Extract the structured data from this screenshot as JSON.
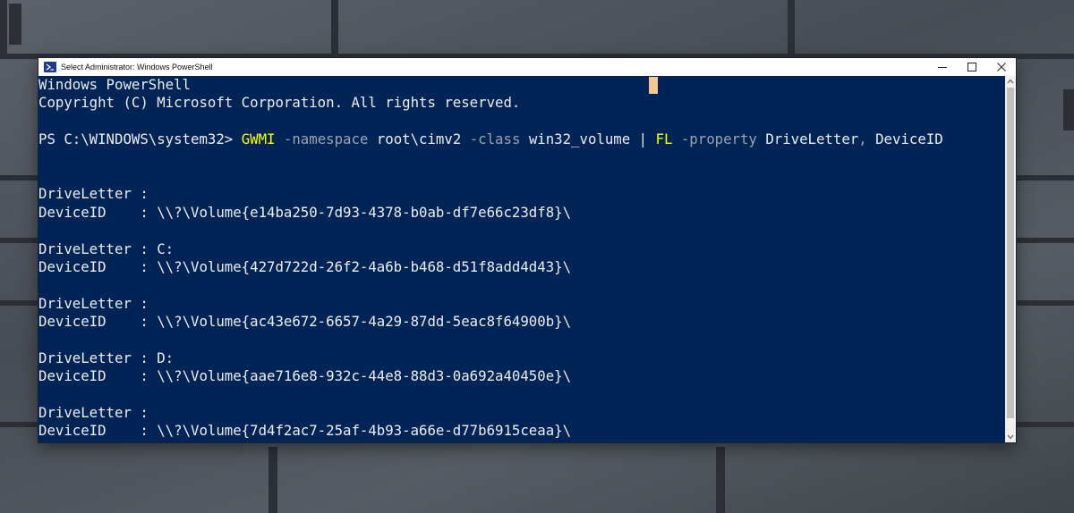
{
  "window": {
    "title": "Select Administrator: Windows PowerShell",
    "icon": "powershell-icon",
    "controls": [
      "minimize-icon",
      "maximize-icon",
      "close-icon"
    ]
  },
  "colors": {
    "console_bg": "#012456",
    "console_text": "#eeedf0",
    "command": "#ffff00",
    "parameter": "#9ca3af",
    "cursor": "#f5c891"
  },
  "console": {
    "header1": "Windows PowerShell",
    "header2": "Copyright (C) Microsoft Corporation. All rights reserved.",
    "prompt": "PS C:\\WINDOWS\\system32> ",
    "command": {
      "cmdlet": "GWMI",
      "sp1": " ",
      "param1": "-namespace",
      "arg1": " root\\cimv2 ",
      "param2": "-class",
      "arg2": " win32_volume ",
      "pipe": "| ",
      "cmdlet2": "FL",
      "sp2": " ",
      "param3": "-property",
      "arg3": " DriveLetter",
      "comma": ",",
      "arg4": " DeviceID"
    },
    "volumes": [
      {
        "drive_label": "DriveLetter : ",
        "drive": "",
        "device_label": "DeviceID    : ",
        "device": "\\\\?\\Volume{e14ba250-7d93-4378-b0ab-df7e66c23df8}\\"
      },
      {
        "drive_label": "DriveLetter : ",
        "drive": "C:",
        "device_label": "DeviceID    : ",
        "device": "\\\\?\\Volume{427d722d-26f2-4a6b-b468-d51f8add4d43}\\"
      },
      {
        "drive_label": "DriveLetter : ",
        "drive": "",
        "device_label": "DeviceID    : ",
        "device": "\\\\?\\Volume{ac43e672-6657-4a29-87dd-5eac8f64900b}\\"
      },
      {
        "drive_label": "DriveLetter : ",
        "drive": "D:",
        "device_label": "DeviceID    : ",
        "device": "\\\\?\\Volume{aae716e8-932c-44e8-88d3-0a692a40450e}\\"
      },
      {
        "drive_label": "DriveLetter : ",
        "drive": "",
        "device_label": "DeviceID    : ",
        "device": "\\\\?\\Volume{7d4f2ac7-25af-4b93-a66e-d77b6915ceaa}\\"
      }
    ]
  }
}
